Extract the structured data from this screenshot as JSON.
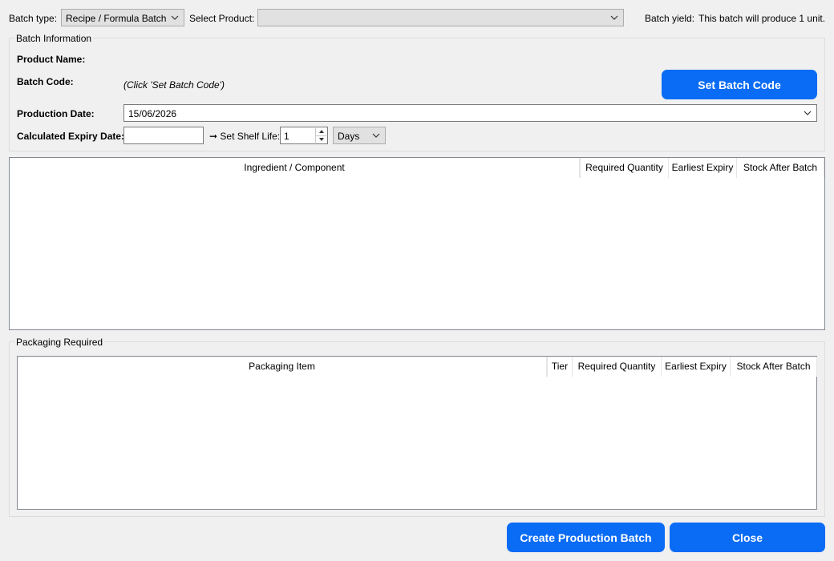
{
  "toolbar": {
    "batch_type_label": "Batch type:",
    "batch_type_value": "Recipe / Formula Batch",
    "select_product_label": "Select Product:",
    "select_product_value": "",
    "batch_yield_label": "Batch yield:",
    "batch_yield_value": "This batch will produce 1 unit."
  },
  "batch_info": {
    "title": "Batch Information",
    "product_name_label": "Product Name:",
    "product_name_value": "",
    "batch_code_label": "Batch Code:",
    "batch_code_hint": "(Click 'Set Batch Code')",
    "set_batch_code_button": "Set Batch Code",
    "production_date_label": "Production Date:",
    "production_date_value": "15/06/2026",
    "expiry_label": "Calculated Expiry Date:",
    "expiry_value": "",
    "shelf_life_label": "➞ Set Shelf Life:",
    "shelf_life_value": "1",
    "shelf_life_unit": "Days"
  },
  "ingredients_table": {
    "columns": [
      "Ingredient / Component",
      "Required Quantity",
      "Earliest Expiry",
      "Stock After Batch"
    ],
    "rows": []
  },
  "packaging": {
    "title": "Packaging Required",
    "columns": [
      "Packaging Item",
      "Tier",
      "Required Quantity",
      "Earliest Expiry",
      "Stock After Batch"
    ],
    "rows": []
  },
  "footer": {
    "create_button": "Create Production Batch",
    "close_button": "Close"
  },
  "colors": {
    "accent": "#0a6cf5",
    "background": "#f0f0f0"
  },
  "icons": {
    "dropdown": "chevron-down-icon",
    "spinner": "spinner-arrows-icon"
  }
}
